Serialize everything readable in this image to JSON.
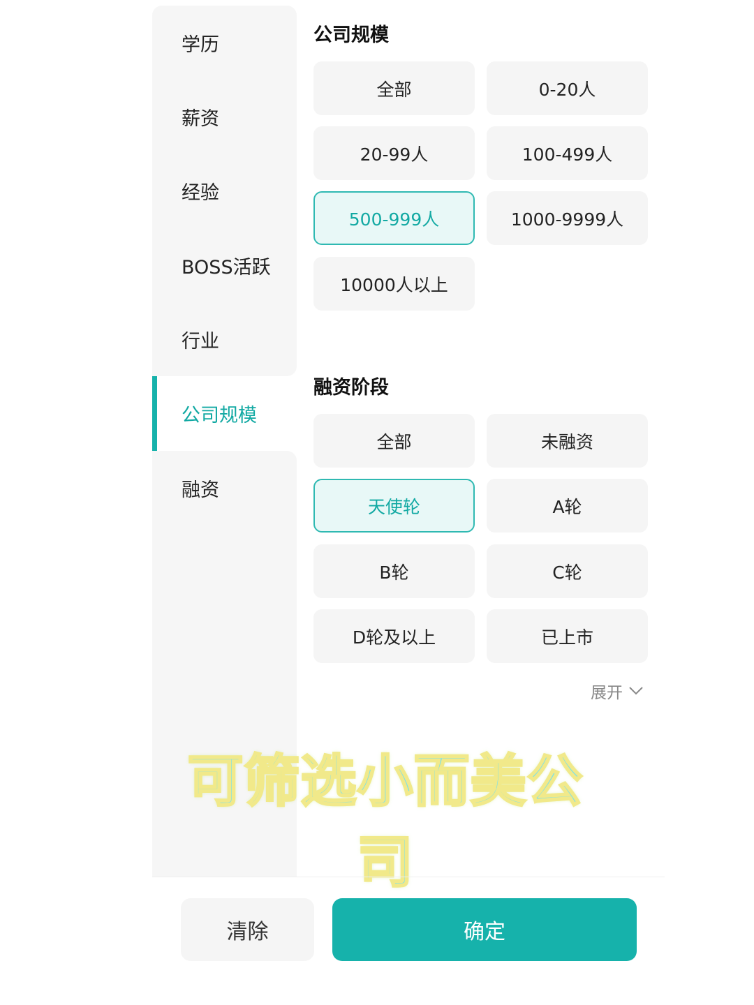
{
  "sidebar": {
    "items": [
      {
        "label": "学历",
        "active": false
      },
      {
        "label": "薪资",
        "active": false
      },
      {
        "label": "经验",
        "active": false
      },
      {
        "label": "BOSS活跃",
        "active": false
      },
      {
        "label": "行业",
        "active": false
      },
      {
        "label": "公司规模",
        "active": true
      },
      {
        "label": "融资",
        "active": false
      }
    ]
  },
  "company_size": {
    "title": "公司规模",
    "options": [
      {
        "label": "全部",
        "selected": false
      },
      {
        "label": "0-20人",
        "selected": false
      },
      {
        "label": "20-99人",
        "selected": false
      },
      {
        "label": "100-499人",
        "selected": false
      },
      {
        "label": "500-999人",
        "selected": true
      },
      {
        "label": "1000-9999人",
        "selected": false
      },
      {
        "label": "10000人以上",
        "selected": false
      }
    ]
  },
  "funding": {
    "title": "融资阶段",
    "options": [
      {
        "label": "全部",
        "selected": false
      },
      {
        "label": "未融资",
        "selected": false
      },
      {
        "label": "天使轮",
        "selected": true
      },
      {
        "label": "A轮",
        "selected": false
      },
      {
        "label": "B轮",
        "selected": false
      },
      {
        "label": "C轮",
        "selected": false
      },
      {
        "label": "D轮及以上",
        "selected": false
      },
      {
        "label": "已上市",
        "selected": false
      }
    ],
    "expand_label": "展开"
  },
  "overlay_caption": "可筛选小而美公司",
  "footer": {
    "clear_label": "清除",
    "confirm_label": "确定"
  },
  "colors": {
    "accent": "#16b2ab",
    "selected_bg": "#e8f8f7",
    "option_bg": "#f5f5f5",
    "sidebar_bg": "#f6f6f6"
  }
}
